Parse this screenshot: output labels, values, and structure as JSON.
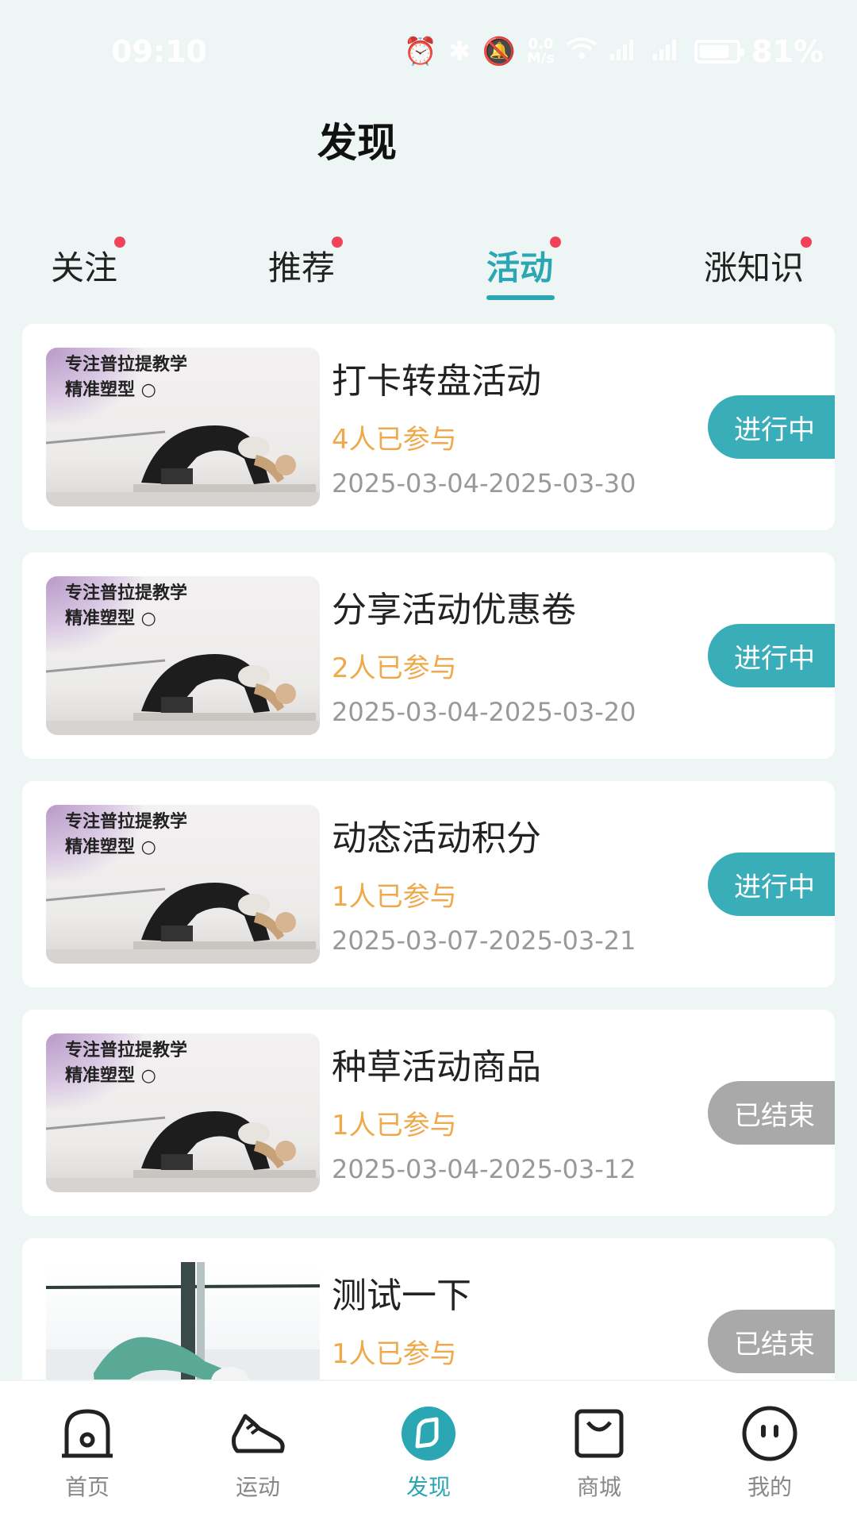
{
  "status_bar": {
    "time": "09:10",
    "net_speed_top": "0.0",
    "net_speed_bottom": "M/s",
    "battery_text": "81%",
    "battery_level": 0.81,
    "icons": [
      "alarm-icon",
      "bluetooth-icon",
      "mute-icon",
      "wifi-icon",
      "signal-icon",
      "signal-icon",
      "battery-icon"
    ]
  },
  "page": {
    "title": "发现"
  },
  "tabs": [
    {
      "label": "关注",
      "dot": true,
      "active": false
    },
    {
      "label": "推荐",
      "dot": true,
      "active": false
    },
    {
      "label": "活动",
      "dot": true,
      "active": true
    },
    {
      "label": "涨知识",
      "dot": true,
      "active": false
    }
  ],
  "activities": [
    {
      "title": "打卡转盘活动",
      "count": "4人已参与",
      "date": "2025-03-04-2025-03-30",
      "status": "进行中",
      "state": "active",
      "promo_line1": "专注普拉提教学",
      "promo_line2": "精准塑型 ○",
      "image": "pilates-promo"
    },
    {
      "title": "分享活动优惠卷",
      "count": "2人已参与",
      "date": "2025-03-04-2025-03-20",
      "status": "进行中",
      "state": "active",
      "promo_line1": "专注普拉提教学",
      "promo_line2": "精准塑型 ○",
      "image": "pilates-promo"
    },
    {
      "title": "动态活动积分",
      "count": "1人已参与",
      "date": "2025-03-07-2025-03-21",
      "status": "进行中",
      "state": "active",
      "promo_line1": "专注普拉提教学",
      "promo_line2": "精准塑型 ○",
      "image": "pilates-promo"
    },
    {
      "title": "种草活动商品",
      "count": "1人已参与",
      "date": "2025-03-04-2025-03-12",
      "status": "已结束",
      "state": "ended",
      "promo_line1": "专注普拉提教学",
      "promo_line2": "精准塑型 ○",
      "image": "pilates-promo"
    },
    {
      "title": "测试一下",
      "count": "1人已参与",
      "date": "",
      "status": "已结束",
      "state": "ended",
      "promo_line1": "",
      "promo_line2": "",
      "image": "pilates-studio-photo"
    }
  ],
  "bottom_nav": [
    {
      "label": "首页",
      "icon": "home-icon",
      "active": false
    },
    {
      "label": "运动",
      "icon": "sneaker-icon",
      "active": false
    },
    {
      "label": "发现",
      "icon": "compass-icon",
      "active": true
    },
    {
      "label": "商城",
      "icon": "shopping-bag-icon",
      "active": false
    },
    {
      "label": "我的",
      "icon": "face-icon",
      "active": false
    }
  ],
  "colors": {
    "accent": "#2ba7b3",
    "dot": "#f0435a",
    "count": "#f0a94a",
    "ended": "#a9a9a9",
    "background": "#eef5f5"
  }
}
